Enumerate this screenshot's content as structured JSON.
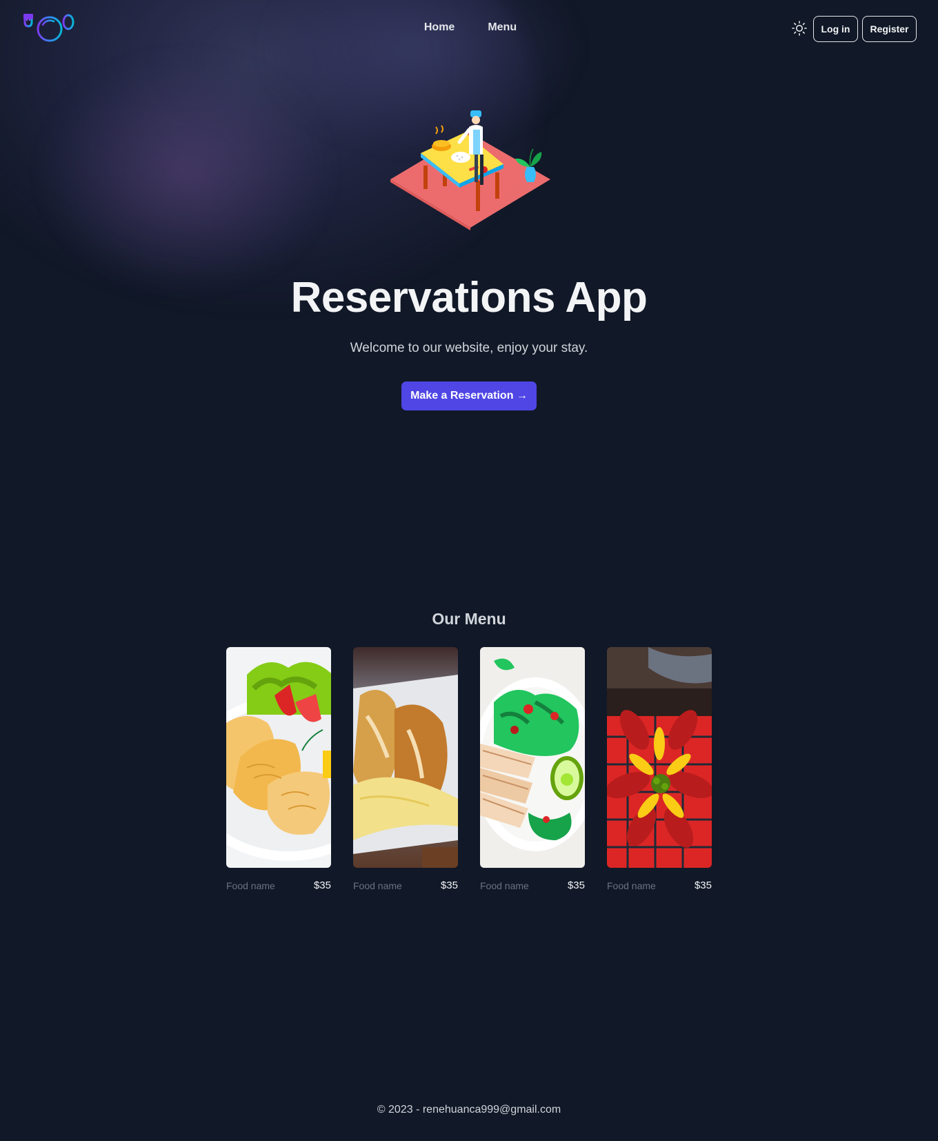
{
  "header": {
    "logo_icon": "fork-plate-spoon-icon",
    "nav": [
      {
        "label": "Home"
      },
      {
        "label": "Menu"
      }
    ],
    "theme_icon": "sun-icon",
    "login_label": "Log in",
    "register_label": "Register"
  },
  "hero": {
    "illustration_icon": "chef-cooking-illustration",
    "title": "Reservations App",
    "subtitle": "Welcome to our website, enjoy your stay.",
    "cta_label": "Make a Reservation →"
  },
  "menu": {
    "heading": "Our Menu",
    "items": [
      {
        "name": "Food name",
        "price": "$35",
        "image": "fish-fillet-salad-photo"
      },
      {
        "name": "Food name",
        "price": "$35",
        "image": "breaded-chicken-sauce-photo"
      },
      {
        "name": "Food name",
        "price": "$35",
        "image": "chicken-avocado-salad-photo"
      },
      {
        "name": "Food name",
        "price": "$35",
        "image": "crayfish-lemon-platter-photo"
      }
    ]
  },
  "footer": {
    "text": "© 2023 - renehuanca999@gmail.com"
  },
  "colors": {
    "background": "#111827",
    "accent": "#4f46e5",
    "text": "#f3f4f6",
    "muted": "#6b7280"
  }
}
